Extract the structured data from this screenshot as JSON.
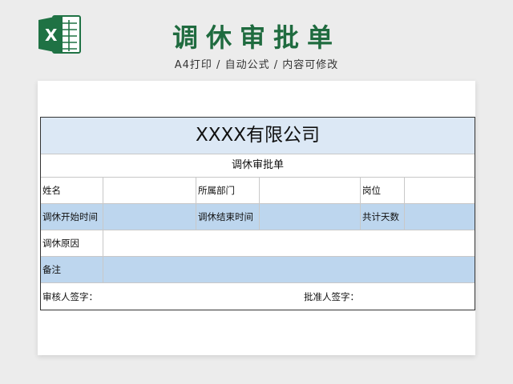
{
  "header": {
    "title": "调休审批单",
    "subtitle": "A4打印 / 自动公式 / 内容可修改"
  },
  "form": {
    "company": "XXXX有限公司",
    "form_title": "调休审批单",
    "name_label": "姓名",
    "dept_label": "所属部门",
    "position_label": "岗位",
    "start_label": "调休开始时间",
    "end_label": "调休结束时间",
    "days_label": "共计天数",
    "reason_label": "调休原因",
    "remark_label": "备注",
    "reviewer_label": "审核人签字：",
    "approver_label": "批准人签字："
  },
  "colors": {
    "brand_green": "#1f6b3f",
    "header_fill": "#dce8f5",
    "row_fill": "#bdd6ee"
  }
}
